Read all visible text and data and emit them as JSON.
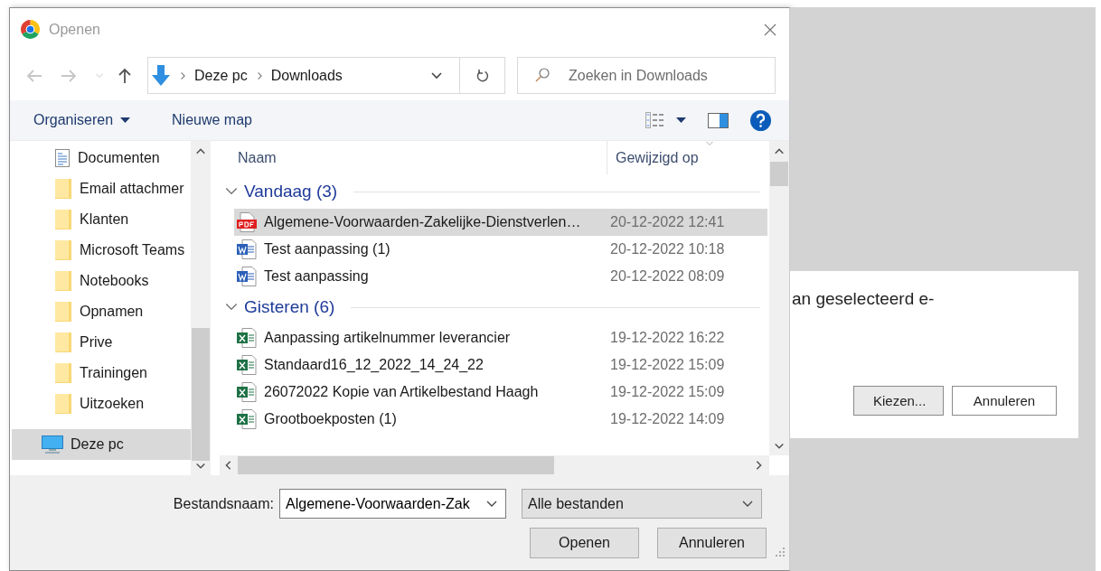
{
  "background_window": {
    "text": "an geselecteerd e-",
    "buttons": [
      {
        "label": "Kiezen...",
        "kind": "default"
      },
      {
        "label": "Annuleren",
        "kind": "plain"
      }
    ]
  },
  "dialog": {
    "title": "Openen",
    "breadcrumb": [
      "Deze pc",
      "Downloads"
    ],
    "search": {
      "placeholder": "Zoeken in Downloads"
    },
    "toolbar": {
      "organize": "Organiseren",
      "new_folder": "Nieuwe map"
    },
    "sidebar": {
      "items": [
        {
          "label": "Documenten",
          "kind": "documents",
          "selected": false
        },
        {
          "label": "Email attachmer",
          "kind": "folder",
          "selected": false
        },
        {
          "label": "Klanten",
          "kind": "folder",
          "selected": false
        },
        {
          "label": "Microsoft Teams",
          "kind": "folder",
          "selected": false
        },
        {
          "label": "Notebooks",
          "kind": "folder",
          "selected": false
        },
        {
          "label": "Opnamen",
          "kind": "folder",
          "selected": false
        },
        {
          "label": "Prive",
          "kind": "folder",
          "selected": false
        },
        {
          "label": "Trainingen",
          "kind": "folder",
          "selected": false
        },
        {
          "label": "Uitzoeken",
          "kind": "folder",
          "selected": false
        },
        {
          "label": "Deze pc",
          "kind": "computer",
          "selected": true
        }
      ]
    },
    "columns": [
      "Naam",
      "Gewijzigd op"
    ],
    "groups": [
      {
        "label": "Vandaag (3)",
        "expanded": true,
        "files": [
          {
            "name": "Algemene-Voorwaarden-Zakelijke-Dienstverlen…",
            "modified": "20-12-2022 12:41",
            "kind": "pdf",
            "selected": true
          },
          {
            "name": "Test aanpassing (1)",
            "modified": "20-12-2022 10:18",
            "kind": "word",
            "selected": false
          },
          {
            "name": "Test aanpassing",
            "modified": "20-12-2022 08:09",
            "kind": "word",
            "selected": false
          }
        ]
      },
      {
        "label": "Gisteren (6)",
        "expanded": true,
        "files": [
          {
            "name": "Aanpassing artikelnummer leverancier",
            "modified": "19-12-2022 16:22",
            "kind": "excel",
            "selected": false
          },
          {
            "name": "Standaard16_12_2022_14_24_22",
            "modified": "19-12-2022 15:09",
            "kind": "excel",
            "selected": false
          },
          {
            "name": "26072022 Kopie van Artikelbestand Haagh",
            "modified": "19-12-2022 15:09",
            "kind": "excel",
            "selected": false
          },
          {
            "name": "Grootboekposten (1)",
            "modified": "19-12-2022 14:09",
            "kind": "excel",
            "selected": false
          }
        ]
      }
    ],
    "filename": {
      "label": "Bestandsnaam:",
      "value": "Algemene-Voorwaarden-Zak"
    },
    "filter": {
      "value": "Alle bestanden"
    },
    "buttons": [
      {
        "label": "Openen"
      },
      {
        "label": "Annuleren"
      }
    ]
  }
}
